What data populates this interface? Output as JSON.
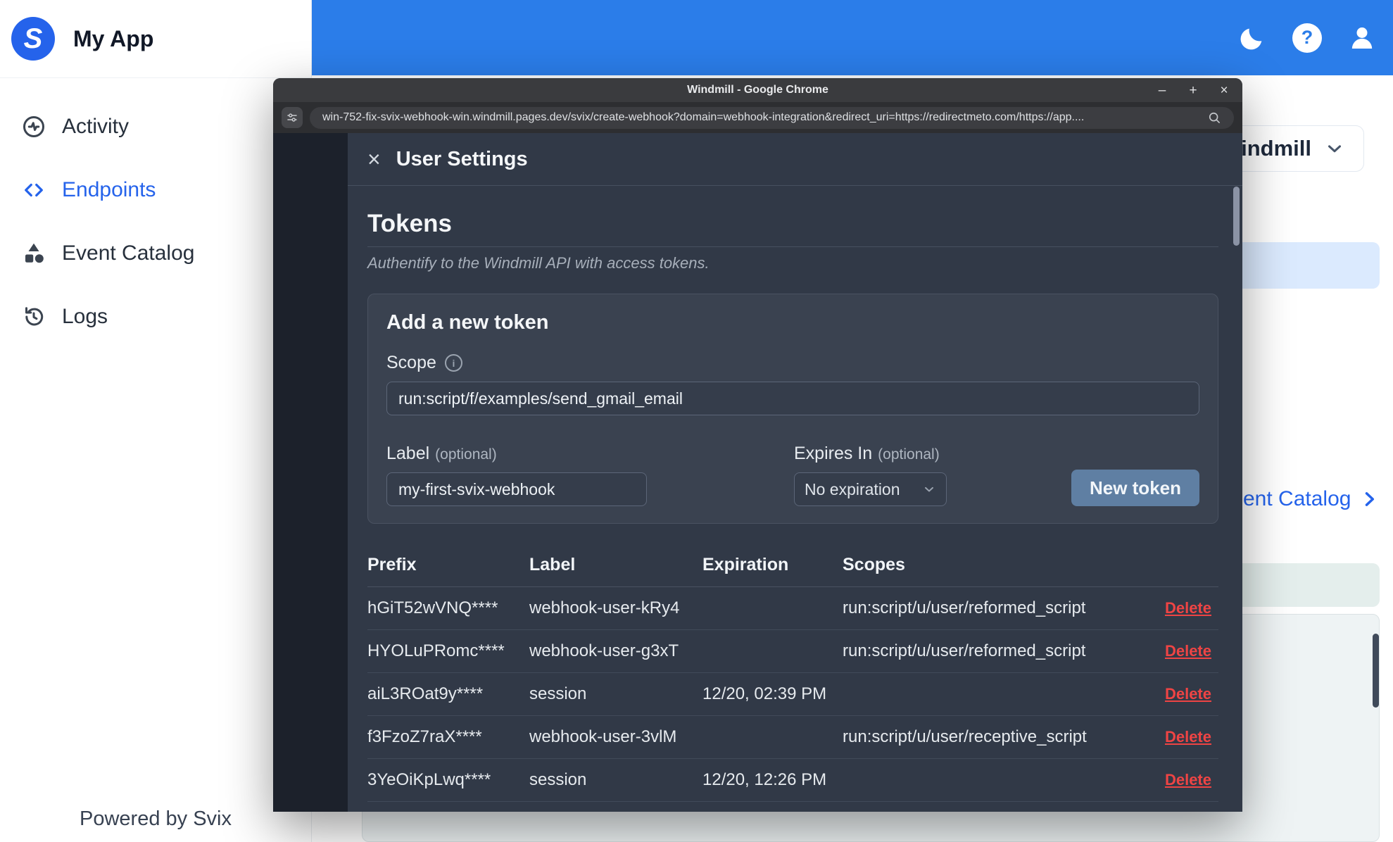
{
  "icons": {
    "close": "×",
    "minimize": "–",
    "maximize": "+",
    "info": "i",
    "help": "?",
    "logo_letter": "S"
  },
  "app": {
    "title": "My App",
    "powered_by": "Powered by Svix",
    "nav": [
      {
        "label": "Activity"
      },
      {
        "label": "Endpoints"
      },
      {
        "label": "Event Catalog"
      },
      {
        "label": "Logs"
      }
    ],
    "background": {
      "dropdown_label": "indmill",
      "catalog_link": "ent Catalog"
    }
  },
  "browser": {
    "window_title": "Windmill - Google Chrome",
    "url": "win-752-fix-svix-webhook-win.windmill.pages.dev/svix/create-webhook?domain=webhook-integration&redirect_uri=https://redirectmeto.com/https://app...."
  },
  "modal": {
    "title": "User Settings",
    "tokens_heading": "Tokens",
    "tokens_subtitle": "Authentify to the Windmill API with access tokens.",
    "form": {
      "heading": "Add a new token",
      "scope_label": "Scope",
      "scope_value": "run:script/f/examples/send_gmail_email",
      "label_label": "Label",
      "optional": "(optional)",
      "label_value": "my-first-svix-webhook",
      "expires_label": "Expires In",
      "expires_value": "No expiration",
      "submit_label": "New token"
    },
    "table": {
      "headers": {
        "prefix": "Prefix",
        "label": "Label",
        "expiration": "Expiration",
        "scopes": "Scopes"
      },
      "delete_label": "Delete",
      "rows": [
        {
          "prefix": "hGiT52wVNQ****",
          "label": "webhook-user-kRy4",
          "expiration": "",
          "scopes": "run:script/u/user/reformed_script"
        },
        {
          "prefix": "HYOLuPRomc****",
          "label": "webhook-user-g3xT",
          "expiration": "",
          "scopes": "run:script/u/user/reformed_script"
        },
        {
          "prefix": "aiL3ROat9y****",
          "label": "session",
          "expiration": "12/20, 02:39 PM",
          "scopes": ""
        },
        {
          "prefix": "f3FzoZ7raX****",
          "label": "webhook-user-3vlM",
          "expiration": "",
          "scopes": "run:script/u/user/receptive_script"
        },
        {
          "prefix": "3YeOiKpLwq****",
          "label": "session",
          "expiration": "12/20, 12:26 PM",
          "scopes": ""
        }
      ]
    }
  },
  "colors": {
    "topbar": "#2b7de9",
    "accent": "#2563eb",
    "delete": "#ef4444"
  }
}
